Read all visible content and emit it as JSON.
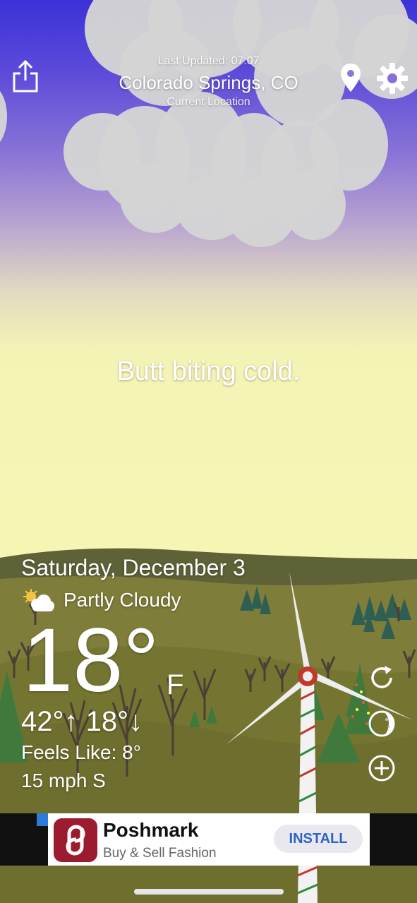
{
  "header": {
    "last_updated": "Last Updated: 07:07",
    "city": "Colorado Springs, CO",
    "location_label": "Current Location"
  },
  "tagline": "Butt biting cold.",
  "weather": {
    "date": "Saturday, December 3",
    "condition": "Partly Cloudy",
    "condition_icon": "partly-cloudy-icon",
    "temperature": "18°",
    "unit": "F",
    "hi_lo": "42°↑ 18°↓",
    "feels_like": "Feels Like: 8°",
    "wind": "15 mph S"
  },
  "actions": [
    "refresh-icon",
    "moon-phase-icon",
    "add-icon"
  ],
  "ad": {
    "title": "Poshmark",
    "subtitle": "Buy & Sell Fashion",
    "button": "INSTALL"
  },
  "colors": {
    "sky_top": "#3b31d8",
    "sky_bottom": "#f6f6b4",
    "ground": "#7e7d39",
    "ad_brand": "#9b1c2e",
    "install_text": "#2c63c9"
  }
}
